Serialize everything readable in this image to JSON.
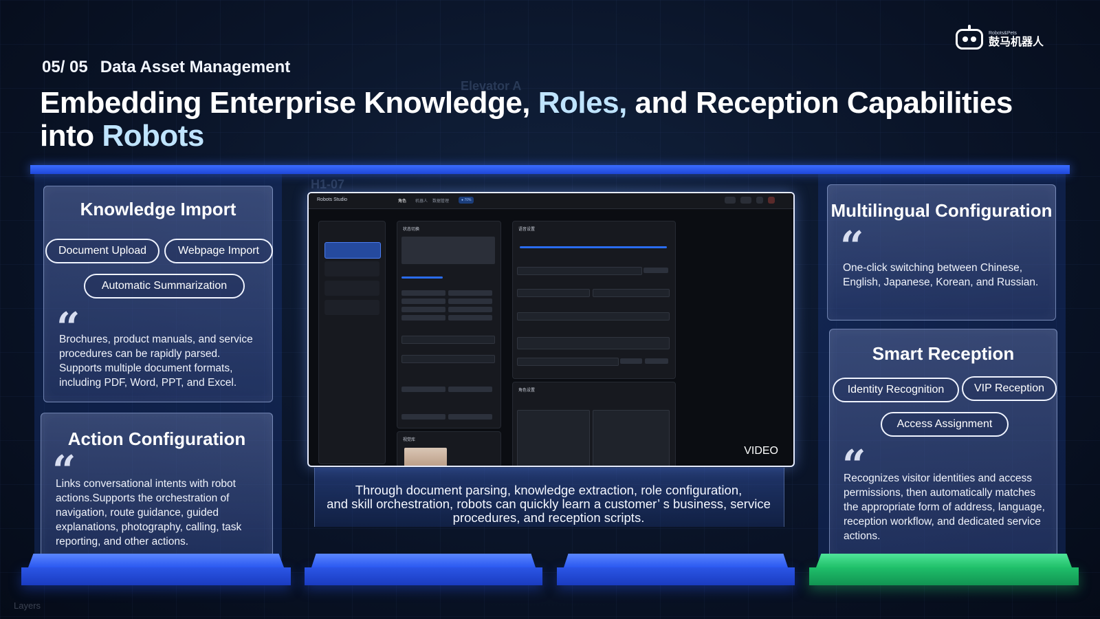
{
  "header": {
    "section_number": "05/ 05",
    "section_name": "Data Asset Management",
    "title_part1": "Embedding Enterprise Knowledge, ",
    "title_highlight1": "Roles,",
    "title_part2": " and Reception Capabilities into ",
    "title_highlight2": "Robots"
  },
  "logo": {
    "small": "Robots&Pets",
    "text": "鼓马机器人"
  },
  "background": {
    "ghost_1": "Elevator A",
    "ghost_2": "H1-07",
    "ghost_layers": "Layers"
  },
  "knowledge_import": {
    "title": "Knowledge Import",
    "pills": [
      "Document Upload",
      "Webpage Import",
      "Automatic Summarization"
    ],
    "quote": "“",
    "text": "Brochures, product manuals, and service procedures can be rapidly parsed. Supports multiple document formats, including PDF, Word, PPT, and Excel."
  },
  "action_configuration": {
    "title": "Action Configuration",
    "quote": "“",
    "text": "Links conversational intents with robot actions.Supports the orchestration of navigation, route guidance, guided explanations, photography, calling, task reporting, and other actions."
  },
  "multilingual": {
    "title": "Multilingual Configuration",
    "quote": "“",
    "text": "One-click switching between Chinese, English, Japanese, Korean, and Russian."
  },
  "smart_reception": {
    "title": "Smart Reception",
    "pills": [
      "Identity Recognition",
      "VIP Reception",
      "Access Assignment"
    ],
    "quote": "“",
    "text": "Recognizes visitor identities and access permissions, then automatically matches the appropriate form of address, language, reception workflow, and dedicated service actions."
  },
  "video": {
    "label": "VIDEO",
    "app_name": "Robots Studio",
    "tabs": [
      "角色",
      "机器人",
      "数据管理"
    ],
    "panel_status": "状态切换",
    "panel_voice": "语音设置",
    "panel_role": "角色设置",
    "panel_preview": "视觉库"
  },
  "caption": {
    "line1": "Through document parsing, knowledge extraction, role configuration,",
    "line2": "and skill orchestration, robots can quickly learn a customer’  s business, service",
    "line3": "procedures, and reception scripts."
  },
  "colors": {
    "accent_blue": "#2d5af0",
    "accent_green": "#22c06a",
    "highlight": "#bfe4ff"
  }
}
